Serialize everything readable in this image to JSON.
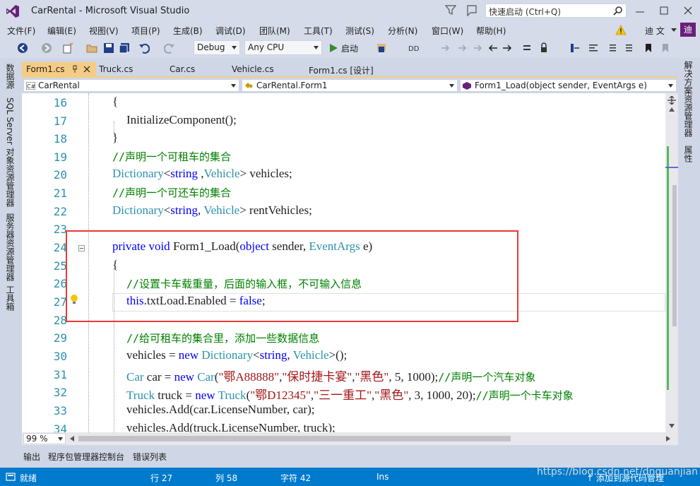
{
  "window": {
    "title": "CarRental - Microsoft Visual Studio",
    "quick_launch_placeholder": "快速启动 (Ctrl+Q)",
    "user": "迪 文",
    "user_badge": "迪"
  },
  "menu": [
    "文件(F)",
    "编辑(E)",
    "视图(V)",
    "项目(P)",
    "生成(B)",
    "调试(D)",
    "团队(M)",
    "工具(T)",
    "测试(S)",
    "分析(N)",
    "窗口(W)",
    "帮助(H)"
  ],
  "toolbar": {
    "config": "Debug",
    "platform": "Any CPU",
    "start": "启动"
  },
  "left_sidebar": [
    "数据源",
    "SQL Server 对象资源管理器",
    "服务器资源管理器",
    "工具箱"
  ],
  "right_sidebar": [
    "解决方案资源管理器",
    "属性"
  ],
  "doc_tabs": [
    "Form1.cs",
    "Truck.cs",
    "Car.cs",
    "Vehicle.cs",
    "Form1.cs [设计]"
  ],
  "nav": {
    "project": "CarRental",
    "type": "CarRental.Form1",
    "member": "Form1_Load(object sender, EventArgs e)"
  },
  "line_numbers": [
    "16",
    "17",
    "18",
    "19",
    "20",
    "21",
    "22",
    "23",
    "24",
    "25",
    "26",
    "27",
    "28",
    "29",
    "30",
    "31",
    "32",
    "33",
    "34"
  ],
  "code": {
    "l16": "{",
    "l17": "InitializeComponent();",
    "l18": "}",
    "l19": "//声明一个可租车的集合",
    "l20": {
      "t1": "Dictionary",
      "p1": "<",
      "t2": "string",
      "p2": " ,",
      "t3": "Vehicle",
      "p3": "> vehicles;"
    },
    "l21": "//声明一个可还车的集合",
    "l22": {
      "t1": "Dictionary",
      "p1": "<",
      "t2": "string",
      "p2": ", ",
      "t3": "Vehicle",
      "p3": "> rentVehicles;"
    },
    "l24": {
      "k1": "private",
      "k2": "void",
      "p1": " Form1_Load(",
      "k3": "object",
      "p2": " sender, ",
      "t1": "EventArgs",
      "p3": " e)"
    },
    "l25": "{",
    "l26": "//设置卡车载重量，后面的输入框，不可输入信息",
    "l27": {
      "k1": "this",
      "p1": ".txtLoad.Enabled = ",
      "k2": "false",
      "p2": ";"
    },
    "l29": "//给可租车的集合里，添加一些数据信息",
    "l30": {
      "p1": "vehicles = ",
      "k1": "new",
      "t1": "Dictionary",
      "p2": "<",
      "t2": "string",
      "p3": ", ",
      "t3": "Vehicle",
      "p4": ">();"
    },
    "l31": {
      "t1": "Car",
      "p1": " car = ",
      "k1": "new",
      "t2": "Car",
      "p2": "(",
      "s1": "\"鄂A88888\"",
      "p3": ",",
      "s2": "\"保时捷卡宴\"",
      "p4": ",",
      "s3": "\"黑色\"",
      "p5": ", 5, 1000);",
      "c1": "//声明一个汽车对象"
    },
    "l32": {
      "t1": "Truck",
      "p1": " truck = ",
      "k1": "new",
      "t2": "Truck",
      "p2": "(",
      "s1": "\"鄂D12345\"",
      "p3": ",",
      "s2": "\"三一重工\"",
      "p4": ",",
      "s3": "\"黑色\"",
      "p5": ", 3, 1000, 20);",
      "c1": "//声明一个卡车对象"
    },
    "l33": "vehicles.Add(car.LicenseNumber, car);",
    "l34": "vehicles.Add(truck.LicenseNumber, truck);"
  },
  "zoom": "99 %",
  "bottom_tabs": [
    "输出",
    "程序包管理器控制台",
    "错误列表"
  ],
  "status": {
    "ready": "就绪",
    "row": "行 27",
    "col": "列 58",
    "char": "字符 42",
    "mode": "Ins",
    "source_control": "添加到源代码管理"
  },
  "watermark": "https://blog.csdn.net/dnguanjian",
  "colors": {
    "accent": "#007acc",
    "active_tab": "#f5cc84",
    "highlight": "#e83a36",
    "keyword": "#0000ff",
    "type": "#2b91af",
    "comment": "#008000",
    "string": "#a31515"
  }
}
